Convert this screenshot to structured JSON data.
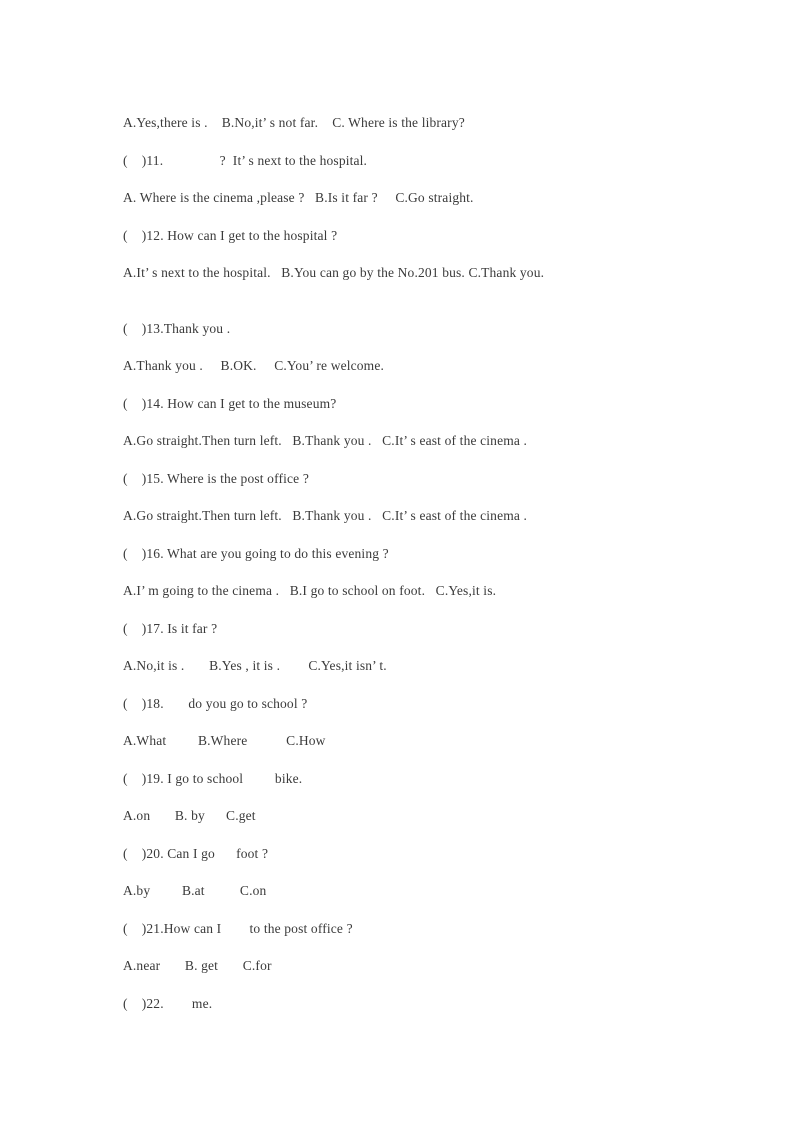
{
  "document": {
    "type": "english-worksheet",
    "text_color": "#3a3a3a",
    "background_color": "#ffffff",
    "lines": [
      {
        "id": "opt-10",
        "kind": "options",
        "text": "A.Yes,there is .    B.No,it’ s not far.    C. Where is the library?"
      },
      {
        "id": "q-11",
        "kind": "question",
        "text": "(    )11.                ?  It’ s next to the hospital."
      },
      {
        "id": "opt-11",
        "kind": "options",
        "text": "A. Where is the cinema ,please ?   B.Is it far ?     C.Go straight."
      },
      {
        "id": "q-12",
        "kind": "question",
        "text": "(    )12. How can I get to the hospital ?"
      },
      {
        "id": "opt-12",
        "kind": "options",
        "text": "A.It’ s next to the hospital.   B.You can go by the No.201 bus. C.Thank you."
      },
      {
        "id": "q-13",
        "kind": "question",
        "text": "(    )13.Thank you ."
      },
      {
        "id": "opt-13",
        "kind": "options",
        "text": "A.Thank you .     B.OK.     C.You’ re welcome."
      },
      {
        "id": "q-14",
        "kind": "question",
        "text": "(    )14. How can I get to the museum?"
      },
      {
        "id": "opt-14",
        "kind": "options",
        "text": "A.Go straight.Then turn left.   B.Thank you .   C.It’ s east of the cinema ."
      },
      {
        "id": "q-15",
        "kind": "question",
        "text": "(    )15. Where is the post office ?"
      },
      {
        "id": "opt-15",
        "kind": "options",
        "text": "A.Go straight.Then turn left.   B.Thank you .   C.It’ s east of the cinema ."
      },
      {
        "id": "q-16",
        "kind": "question",
        "text": "(    )16. What are you going to do this evening ?"
      },
      {
        "id": "opt-16",
        "kind": "options",
        "text": "A.I’ m going to the cinema .   B.I go to school on foot.   C.Yes,it is."
      },
      {
        "id": "q-17",
        "kind": "question",
        "text": "(    )17. Is it far ?"
      },
      {
        "id": "opt-17",
        "kind": "options",
        "text": "A.No,it is .       B.Yes , it is .        C.Yes,it isn’ t."
      },
      {
        "id": "q-18",
        "kind": "question",
        "text": "(    )18.       do you go to school ?"
      },
      {
        "id": "opt-18",
        "kind": "options",
        "text": "A.What         B.Where           C.How"
      },
      {
        "id": "q-19",
        "kind": "question",
        "text": "(    )19. I go to school         bike."
      },
      {
        "id": "opt-19",
        "kind": "options",
        "text": "A.on       B. by      C.get"
      },
      {
        "id": "q-20",
        "kind": "question",
        "text": "(    )20. Can I go      foot ?"
      },
      {
        "id": "opt-20",
        "kind": "options",
        "text": "A.by         B.at          C.on"
      },
      {
        "id": "q-21",
        "kind": "question",
        "text": "(    )21.How can I        to the post office ?"
      },
      {
        "id": "opt-21",
        "kind": "options",
        "text": "A.near       B. get       C.for"
      },
      {
        "id": "q-22",
        "kind": "question",
        "text": "(    )22.        me."
      }
    ]
  }
}
